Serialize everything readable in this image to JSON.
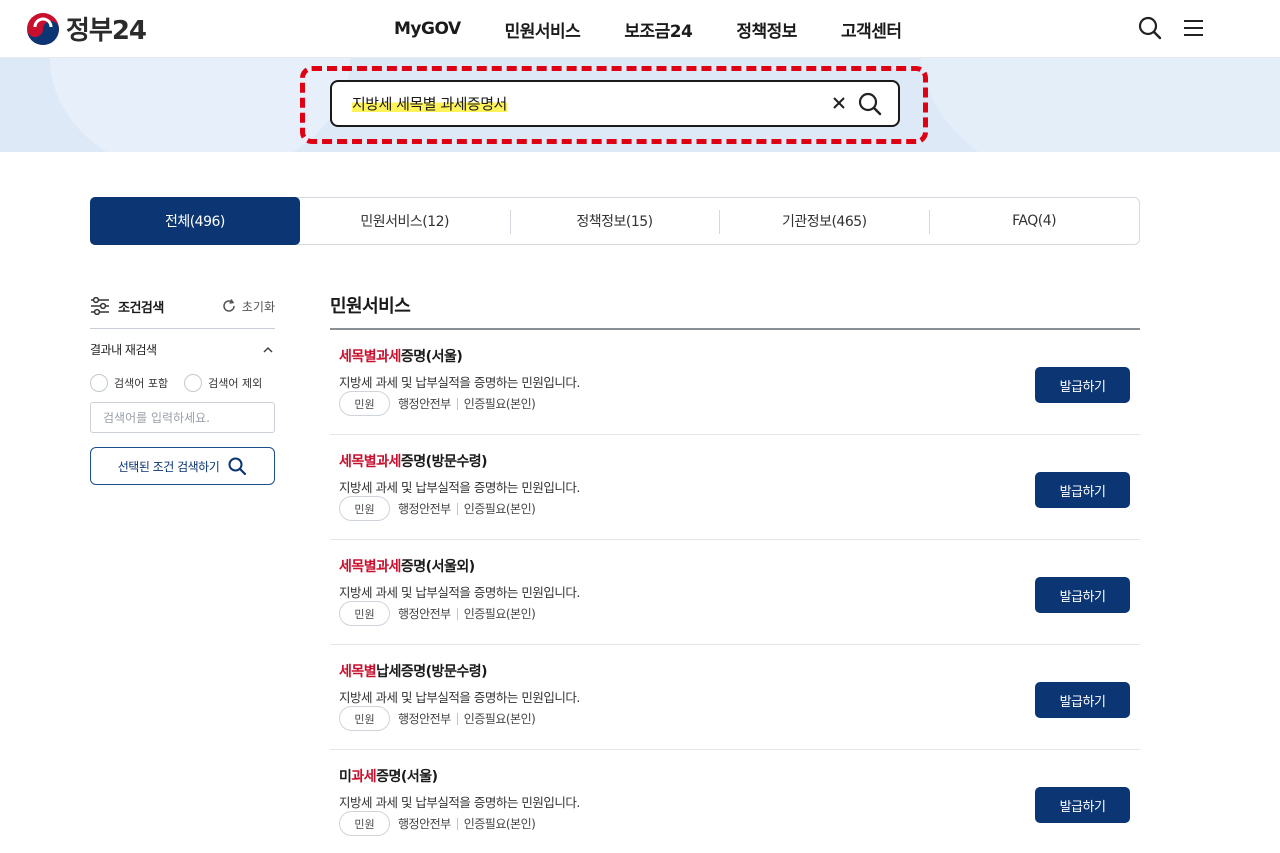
{
  "header": {
    "logo_text": "정부24",
    "nav": [
      "MyGOV",
      "민원서비스",
      "보조금24",
      "정책정보",
      "고객센터"
    ],
    "icons": [
      "search-icon",
      "hamburger-menu-icon"
    ]
  },
  "search": {
    "value": "지방세 세목별 과세증명서",
    "clear_icon": "close-icon",
    "submit_icon": "search-icon"
  },
  "tabs": [
    {
      "label": "전체(496)",
      "active": true
    },
    {
      "label": "민원서비스(12)",
      "active": false
    },
    {
      "label": "정책정보(15)",
      "active": false
    },
    {
      "label": "기관정보(465)",
      "active": false
    },
    {
      "label": "FAQ(4)",
      "active": false
    }
  ],
  "filter": {
    "title": "조건검색",
    "reset_label": "초기화",
    "re_search_label": "결과내 재검색",
    "radio_include": "검색어 포함",
    "radio_exclude": "검색어 제외",
    "input_placeholder": "검색어를 입력하세요.",
    "search_button": "선택된 조건 검색하기"
  },
  "results": {
    "section_title": "민원서비스",
    "items": [
      {
        "title_hl": "세목별과세",
        "title_rest": "증명(서울)",
        "desc": "지방세 과세 및 납부실적을 증명하는 민원입니다.",
        "badge": "민원",
        "org": "행정안전부",
        "auth": "인증필요(본인)",
        "button": "발급하기"
      },
      {
        "title_hl": "세목별과세",
        "title_rest": "증명(방문수령)",
        "desc": "지방세 과세 및 납부실적을 증명하는 민원입니다.",
        "badge": "민원",
        "org": "행정안전부",
        "auth": "인증필요(본인)",
        "button": "발급하기"
      },
      {
        "title_hl": "세목별과세",
        "title_rest": "증명(서울외)",
        "desc": "지방세 과세 및 납부실적을 증명하는 민원입니다.",
        "badge": "민원",
        "org": "행정안전부",
        "auth": "인증필요(본인)",
        "button": "발급하기"
      },
      {
        "title_hl": "세목별",
        "title_rest": "납세증명(방문수령)",
        "desc": "지방세 과세 및 납부실적을 증명하는 민원입니다.",
        "badge": "민원",
        "org": "행정안전부",
        "auth": "인증필요(본인)",
        "button": "발급하기"
      },
      {
        "title_pre": "미",
        "title_hl": "과세",
        "title_rest": "증명(서울)",
        "desc": "지방세 과세 및 납부실적을 증명하는 민원입니다.",
        "badge": "민원",
        "org": "행정안전부",
        "auth": "인증필요(본인)",
        "button": "발급하기"
      }
    ]
  },
  "colors": {
    "primary_navy": "#0b3573",
    "highlight_red": "#c8102e",
    "annotation_dash": "#e00014",
    "search_highlight": "#fff35a"
  }
}
